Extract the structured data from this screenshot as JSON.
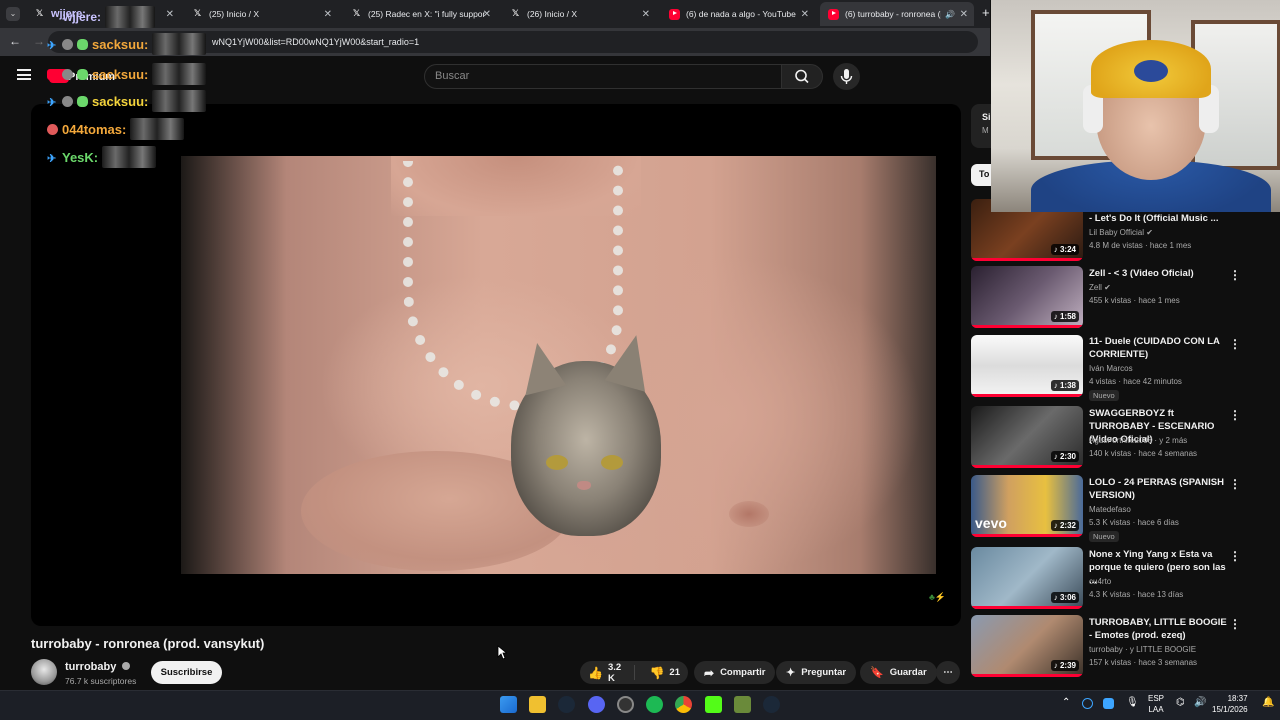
{
  "browser": {
    "tabs": [
      {
        "title": "wjjere:",
        "icon": "x-icon"
      },
      {
        "title": "(25) Inicio / X",
        "icon": "x-icon"
      },
      {
        "title": "(25) Radec en X: \"i fully suppor",
        "icon": "x-icon"
      },
      {
        "title": "(26) Inicio / X",
        "icon": "x-icon"
      },
      {
        "title": "(6) de nada a algo - YouTube",
        "icon": "youtube-icon"
      },
      {
        "title": "(6) turrobaby - ronronea (p",
        "icon": "youtube-icon",
        "active": true
      }
    ],
    "url": "wNQ1YjW00&list=RD00wNQ1YjW00&start_radio=1",
    "new_tab_label": "+"
  },
  "masthead": {
    "logo_label": "Premium",
    "search_placeholder": "Buscar"
  },
  "chat_overlay": [
    {
      "user": "wjjere:",
      "color": "#c9c3ff"
    },
    {
      "user": "sacksuu:",
      "color": "#f3a83b"
    },
    {
      "user": "sacksuu:",
      "color": "#f3a83b"
    },
    {
      "user": "sacksuu:",
      "color": "#f3d33b"
    },
    {
      "user": "044tomas:",
      "color": "#f3a83b"
    },
    {
      "user": "YesK:",
      "color": "#6bd86b"
    }
  ],
  "video": {
    "title": "turrobaby - ronronea (prod. vansykut)",
    "channel": "turrobaby",
    "subscribers": "76.7 k suscriptores",
    "subscribe_label": "Suscribirse",
    "likes": "3.2 K",
    "dislikes": "21",
    "share_label": "Compartir",
    "ask_label": "Preguntar",
    "save_label": "Guardar"
  },
  "sidebar": {
    "top_label_1": "Si",
    "top_label_2": "M",
    "chip_label": "To",
    "recommendations": [
      {
        "title": "- Let's Do It (Official Music ...",
        "channel": "Lil Baby Official",
        "meta": "4.8 M de vistas · hace 1 mes",
        "duration": "3:24",
        "new": ""
      },
      {
        "title": "Zell - < 3 (Video Oficial)",
        "channel": "Zell",
        "meta": "455 k vistas · hace 1 mes",
        "duration": "1:58",
        "new": ""
      },
      {
        "title": "11- Duele (CUIDADO CON LA CORRIENTE)",
        "channel": "Iván Marcos",
        "meta": "4 vistas · hace 42 minutos",
        "duration": "1:38",
        "new": "Nuevo"
      },
      {
        "title": "SWAGGERBOYZ ft TURROBABY - ESCENARIO (Video Oficial)",
        "channel": "AgusFortnite2008 · y 2 más",
        "meta": "140 k vistas · hace 4 semanas",
        "duration": "2:30",
        "new": ""
      },
      {
        "title": "LOLO - 24 PERRAS (SPANISH VERSION)",
        "channel": "Matedefaso",
        "meta": "5.3 K vistas · hace 6 días",
        "duration": "2:32",
        "new": "Nuevo"
      },
      {
        "title": "None x Ying Yang x Esta va porque te quiero (pero son las ...",
        "channel": "cu4rto",
        "meta": "4.3 K vistas · hace 13 días",
        "duration": "3:06",
        "new": ""
      },
      {
        "title": "TURROBABY, LITTLE BOOGIE - Emotes (prod. ezeq)",
        "channel": "turrobaby · y LITTLE BOOGIE",
        "meta": "157 k vistas · hace 3 semanas",
        "duration": "2:39",
        "new": ""
      }
    ]
  },
  "taskbar": {
    "lang_1": "ESP",
    "lang_2": "LAA",
    "time": "18:37",
    "date": "15/1/2026"
  }
}
